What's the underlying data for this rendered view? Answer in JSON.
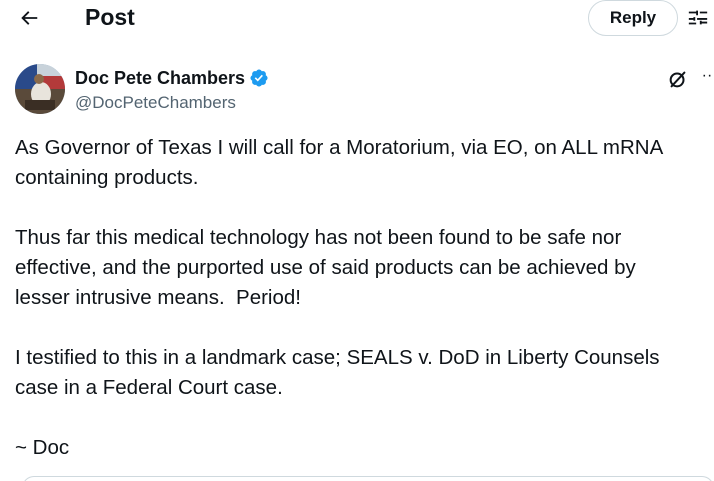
{
  "header": {
    "title": "Post",
    "reply_label": "Reply",
    "back_icon": "arrow-left-icon",
    "filter_icon": "sliders-icon"
  },
  "author": {
    "name": "Doc Pete Chambers",
    "handle": "@DocPeteChambers",
    "verified": true,
    "verified_color": "#1d9bf0"
  },
  "tweet": {
    "paragraphs": [
      [
        "As Governor of Texas I will call for a Moratorium, via EO, on ALL mRNA",
        "containing products."
      ],
      [
        "Thus far this medical technology has not been found to be safe nor",
        "effective, and the purported use of said products can be achieved by",
        "lesser intrusive means.  Period!"
      ],
      [
        "I testified to this in a landmark case; SEALS v. DoD in Liberty Counsels",
        "case in a Federal Court case."
      ],
      [
        "~ Doc"
      ]
    ]
  },
  "colors": {
    "text": "#0f1419",
    "secondary": "#536471",
    "border": "#cfd9de"
  }
}
